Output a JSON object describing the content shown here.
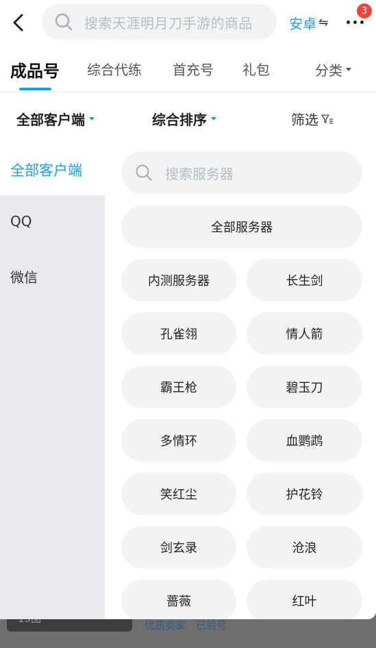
{
  "header": {
    "search_placeholder": "搜索天涯明月刀手游的商品",
    "platform_label": "安卓",
    "platform_switch_glyph": "⇋",
    "notification_count": "3"
  },
  "tabs": [
    {
      "label": "成品号",
      "active": true
    },
    {
      "label": "综合代练",
      "active": false
    },
    {
      "label": "首充号",
      "active": false
    },
    {
      "label": "礼包",
      "active": false
    }
  ],
  "category_tab_label": "分类",
  "filters": {
    "client": "全部客户端",
    "sort": "综合排序",
    "screen": "筛选"
  },
  "sidebar": {
    "items": [
      {
        "label": "全部客户端",
        "active": true
      },
      {
        "label": "QQ",
        "active": false
      },
      {
        "label": "微信",
        "active": false
      }
    ]
  },
  "servers": {
    "search_placeholder": "搜索服务器",
    "all_label": "全部服务器",
    "items": [
      "内测服务器",
      "长生剑",
      "孔雀翎",
      "情人箭",
      "霸王枪",
      "碧玉刀",
      "多情环",
      "血鹦鹉",
      "笑红尘",
      "护花铃",
      "剑玄录",
      "沧浪",
      "蔷薇",
      "红叶"
    ]
  },
  "background_list": {
    "image_count": "13图",
    "tags": [
      "优质卖家",
      "已验号"
    ]
  },
  "colors": {
    "accent": "#1aa1e6",
    "badge": "#f0433a",
    "overlay": "#6e6e70"
  }
}
